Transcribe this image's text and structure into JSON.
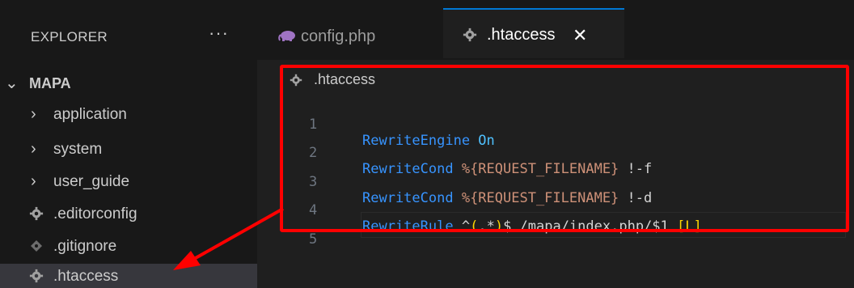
{
  "sidebar": {
    "title": "EXPLORER",
    "more": "···",
    "root": {
      "label": "MAPA"
    },
    "folders": [
      {
        "label": "application"
      },
      {
        "label": "system"
      },
      {
        "label": "user_guide"
      }
    ],
    "files": [
      {
        "label": ".editorconfig",
        "icon": "gear-icon"
      },
      {
        "label": ".gitignore",
        "icon": "git-icon"
      },
      {
        "label": ".htaccess",
        "icon": "gear-icon",
        "selected": true
      }
    ]
  },
  "tabs": [
    {
      "label": "config.php",
      "icon": "php-elephant-icon",
      "active": false
    },
    {
      "label": ".htaccess",
      "icon": "gear-icon",
      "active": true,
      "close": "✕"
    }
  ],
  "editor": {
    "breadcrumb": ".htaccess",
    "line_numbers": [
      "1",
      "2",
      "3",
      "4",
      "5"
    ],
    "lines": [
      {
        "t1": "RewriteEngine",
        "t2": " On"
      },
      {
        "t1": "RewriteCond",
        "t2": " %{REQUEST_FILENAME}",
        "t3": " !-f"
      },
      {
        "t1": "RewriteCond",
        "t2": " %{REQUEST_FILENAME}",
        "t3": " !-d"
      },
      {
        "t1": "RewriteRule",
        "t2": " ^",
        "t3": "(",
        "t4": ".*",
        "t5": ")",
        "t6": "$ /mapa/index.php/$1 ",
        "t7": "[L]"
      }
    ]
  },
  "colors": {
    "annotation": "#ff0000",
    "accent": "#0078d4"
  }
}
